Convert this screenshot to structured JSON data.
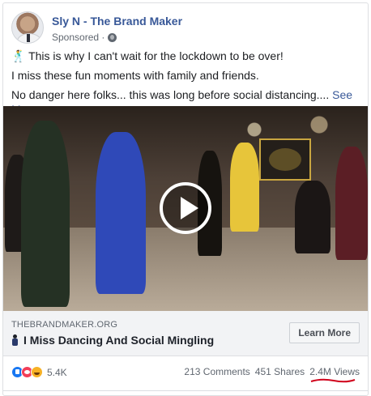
{
  "post": {
    "page_name": "Sly N - The Brand Maker",
    "sponsored_label": "Sponsored ·",
    "text": {
      "line1": "🕺 This is why I can't wait for the lockdown to be over!",
      "line2": "I miss these fun moments with family and friends.",
      "line3": "No danger here folks... this was long before social distancing....",
      "see_more": "See More"
    }
  },
  "link": {
    "domain": "THEBRANDMAKER.ORG",
    "title": "I Miss Dancing And Social Mingling",
    "cta": "Learn More"
  },
  "stats": {
    "reaction_count": "5.4K",
    "comments": "213 Comments",
    "shares": "451 Shares",
    "views": "2.4M Views"
  },
  "colors": {
    "accent": "#385898",
    "like": "#1877f2",
    "love": "#f33e58",
    "haha": "#f7b125",
    "annotation": "#d0021b"
  },
  "icons": [
    "avatar",
    "globe-icon",
    "play-icon",
    "dancer-icon",
    "like-icon",
    "love-icon",
    "haha-icon"
  ]
}
